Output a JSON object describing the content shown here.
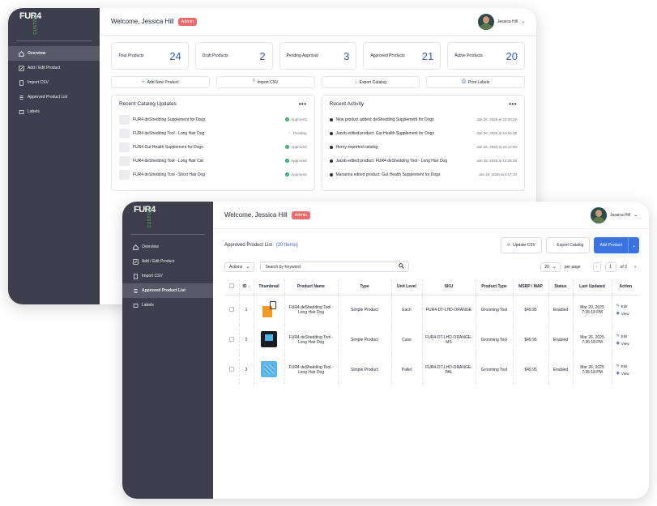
{
  "brand": {
    "logo_text": "FUR4",
    "logo_sub": "CUSTOM"
  },
  "nav": {
    "items": [
      {
        "label": "Overview",
        "icon": "home-icon"
      },
      {
        "label": "Add / Edit Product",
        "icon": "edit-icon"
      },
      {
        "label": "Import CSV",
        "icon": "upload-icon"
      },
      {
        "label": "Approved Product List",
        "icon": "list-icon"
      },
      {
        "label": "Labels",
        "icon": "tag-icon"
      }
    ]
  },
  "header": {
    "welcome": "Welcome, Jessica Hill",
    "badge": "Admin",
    "user_name": "Jessica Hill"
  },
  "dashboard": {
    "stats": [
      {
        "label": "Total Products",
        "value": "24"
      },
      {
        "label": "Draft Products",
        "value": "2"
      },
      {
        "label": "Pending Approval",
        "value": "3"
      },
      {
        "label": "Approved Products",
        "value": "21"
      },
      {
        "label": "Active Products",
        "value": "20"
      }
    ],
    "actions": [
      {
        "label": "Add New Product",
        "icon": "+"
      },
      {
        "label": "Import CSV",
        "icon": "⤒"
      },
      {
        "label": "Export Catalog",
        "icon": "↓"
      },
      {
        "label": "Print Labels",
        "icon": "⎙"
      }
    ],
    "updates": {
      "title": "Recent Catalog Updates",
      "rows": [
        {
          "name": "FUR4 deShedding Supplement for Dogs",
          "status": "Approved"
        },
        {
          "name": "FUR4 deShedding Tool - Long Hair Dog",
          "status": "Pending"
        },
        {
          "name": "FUR4 Gut Health Supplement for Dogs",
          "status": "Approved"
        },
        {
          "name": "FUR4 deShedding Tool - Long Hair Cat",
          "status": "Approved"
        },
        {
          "name": "FUR4 deShedding Tool - Short Hair Dog",
          "status": "Approved"
        }
      ]
    },
    "activity": {
      "title": "Recent Activity",
      "rows": [
        {
          "text": "New product added: deShedding Supplement for Dogs",
          "time": "Jan 26, 2026 at 22:25:22"
        },
        {
          "text": "Jacob edited product: Gut Health Supplement for Dogs",
          "time": "Jan 26, 2026 at 10:05:45"
        },
        {
          "text": "Henry exported catalog",
          "time": "Jan 25, 2026 at 20:12:20"
        },
        {
          "text": "Jacob edited product: FUR4 deShedding Tool - Long Hair Dog",
          "time": "Jan 25, 2026 at 13:05:35"
        },
        {
          "text": "Marianna edited product: Gut Health Supplement for Dogs",
          "time": "Jan 25, 2026 at 8:17:30"
        }
      ]
    }
  },
  "product_list": {
    "title": "Approved Product List",
    "count": "(20 Items)",
    "update_csv": "Update CSV",
    "export_catalog": "Export Catalog",
    "add_product": "Add Product",
    "actions_label": "Actions",
    "search_placeholder": "Search by Keyword",
    "per_page_value": "20",
    "per_page_label": "per page",
    "page": "1",
    "of_pages": "of 2",
    "columns": [
      "ID",
      "Thumbnail",
      "Product Name",
      "Type",
      "Unit Level",
      "SKU",
      "Product Type",
      "MSRP / MAP",
      "Status",
      "Last Updated",
      "Action"
    ],
    "rows": [
      {
        "id": "1",
        "name": "FUR4 deShedding Tool - Long Hair Dog",
        "type": "Simple Product",
        "unit": "Each",
        "sku": "FUR4-DT-LHD-ORANGE",
        "ptype": "Grooming Tool",
        "price": "$49.95",
        "status": "Enabled",
        "updated": "Mar 20, 2025 7:35:18 PM"
      },
      {
        "id": "2",
        "name": "FUR4 deShedding Tool - Long Hair Dog",
        "type": "Simple Product",
        "unit": "Case",
        "sku": "FUR4-DT-LHD-ORANGE-MS",
        "ptype": "Grooming Tool",
        "price": "$49.95",
        "status": "Enabled",
        "updated": "Mar 26, 2025 7:35:18 PM"
      },
      {
        "id": "3",
        "name": "FUR4 deShedding Tool - Long Hair Dog",
        "type": "Simple Product",
        "unit": "Pallet",
        "sku": "FUR4-DT-LHD-ORANGE-PAL",
        "ptype": "Grooming Tool",
        "price": "$49.95",
        "status": "Enabled",
        "updated": "Mar 26, 2025 7:35:18 PM"
      }
    ],
    "edit_label": "Edit",
    "view_label": "View"
  },
  "colors": {
    "sidebar": "#3f3e4d",
    "accent": "#3661c6",
    "badge": "#ec6a6a",
    "primary_button": "#3a73df",
    "approved": "#2eaa5c"
  }
}
